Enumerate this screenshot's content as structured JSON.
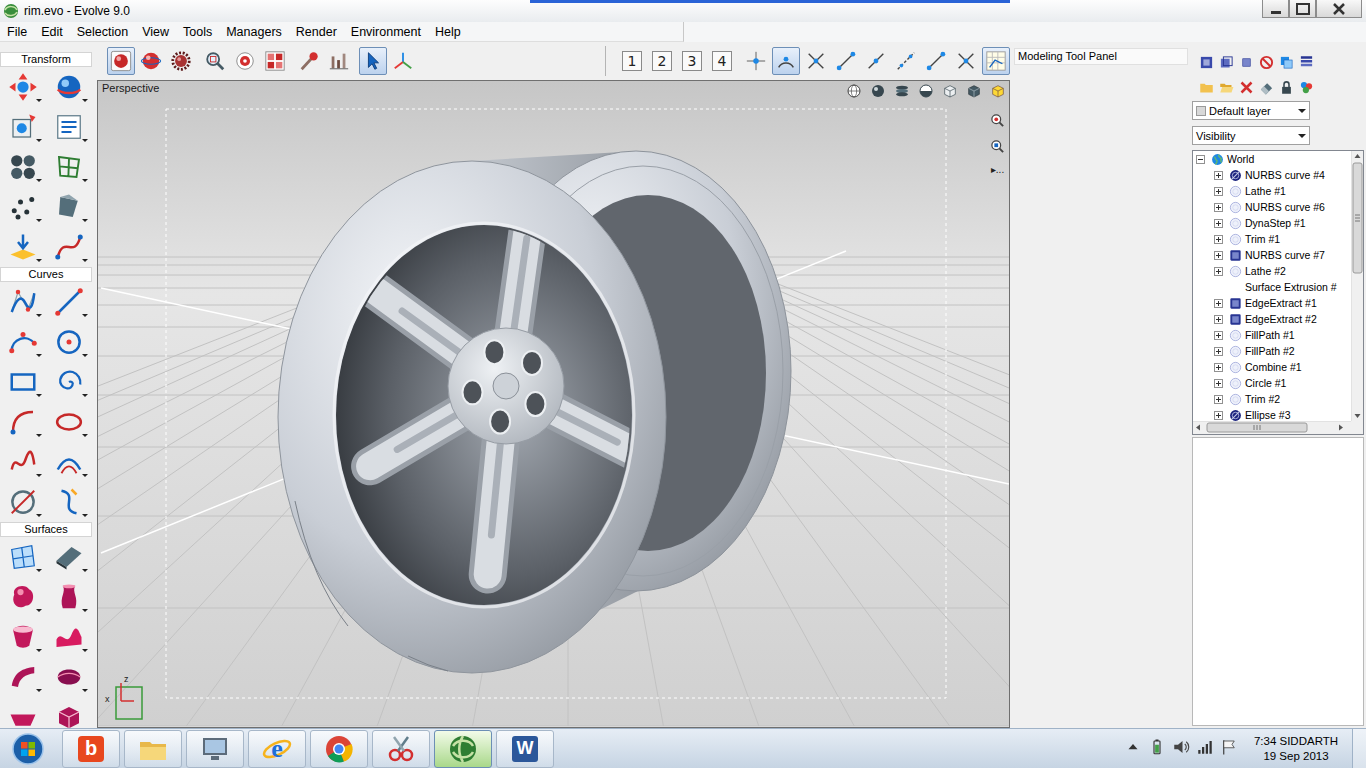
{
  "window": {
    "title": "rim.evo - Evolve 9.0"
  },
  "menu": [
    "File",
    "Edit",
    "Selection",
    "View",
    "Tools",
    "Managers",
    "Render",
    "Environment",
    "Help"
  ],
  "toolbar": {
    "left": [
      [
        {
          "kind": "render",
          "selected": true
        },
        {
          "kind": "red-sphere",
          "selected": false
        },
        {
          "kind": "gear",
          "selected": false
        }
      ],
      [
        {
          "kind": "zoom-fit",
          "selected": false
        },
        {
          "kind": "zoom-red",
          "selected": false
        },
        {
          "kind": "quad",
          "selected": false
        }
      ],
      [
        {
          "kind": "brush",
          "selected": false
        },
        {
          "kind": "measure",
          "selected": false
        }
      ],
      [
        {
          "kind": "pointer",
          "selected": true
        },
        {
          "kind": "axes",
          "selected": false
        }
      ]
    ],
    "right": [
      [
        {
          "kind": "view",
          "label": "1",
          "selected": false
        },
        {
          "kind": "view",
          "label": "2",
          "selected": false
        },
        {
          "kind": "view",
          "label": "3",
          "selected": false
        },
        {
          "kind": "view",
          "label": "4",
          "selected": false
        }
      ],
      [
        {
          "kind": "snap-point",
          "selected": false
        },
        {
          "kind": "snap-arc",
          "selected": true
        },
        {
          "kind": "snap-cross",
          "selected": false
        },
        {
          "kind": "snap-end",
          "selected": false
        },
        {
          "kind": "snap-mid",
          "selected": false
        },
        {
          "kind": "snap-dash",
          "selected": false
        },
        {
          "kind": "snap-end",
          "selected": false
        },
        {
          "kind": "snap-cross",
          "selected": false
        },
        {
          "kind": "snap-grid",
          "selected": true
        }
      ]
    ]
  },
  "tool_sections": [
    {
      "title": "Transform",
      "tools": [
        "move",
        "rotate",
        "move-frame",
        "props",
        "array",
        "lattice",
        "points",
        "twist",
        "drop",
        "path"
      ]
    },
    {
      "title": "Curves",
      "tools": [
        "curve",
        "line",
        "arc",
        "circle",
        "rect",
        "spiral",
        "arc-open",
        "ellipse",
        "freeform",
        "offset",
        "circle-cut",
        "scurve"
      ]
    },
    {
      "title": "Surfaces",
      "tools": [
        "patch",
        "plane",
        "blob",
        "vase",
        "lathe",
        "wave",
        "sweep",
        "shell",
        "boat",
        "solid"
      ]
    }
  ],
  "viewport": {
    "label": "Perspective",
    "more": "▸...",
    "gizmo": {
      "z": "z",
      "x": "x"
    }
  },
  "tool_panel": {
    "title": "Modeling Tool Panel"
  },
  "layers": {
    "layer": "Default layer",
    "filter": "Visibility"
  },
  "tree": {
    "items": [
      {
        "label": "World",
        "kind": "world",
        "depth": 0,
        "expanded": true,
        "leaf": false
      },
      {
        "label": "NURBS curve #4",
        "kind": "dark",
        "depth": 1,
        "expanded": false,
        "leaf": false
      },
      {
        "label": "Lathe #1",
        "kind": "light",
        "depth": 1,
        "expanded": false,
        "leaf": false
      },
      {
        "label": "NURBS curve #6",
        "kind": "light",
        "depth": 1,
        "expanded": false,
        "leaf": false
      },
      {
        "label": "DynaStep #1",
        "kind": "light",
        "depth": 1,
        "expanded": false,
        "leaf": false
      },
      {
        "label": "Trim #1",
        "kind": "light",
        "depth": 1,
        "expanded": false,
        "leaf": false
      },
      {
        "label": "NURBS curve #7",
        "kind": "box",
        "depth": 1,
        "expanded": false,
        "leaf": false
      },
      {
        "label": "Lathe #2",
        "kind": "light",
        "depth": 1,
        "expanded": false,
        "leaf": false
      },
      {
        "label": "Surface Extrusion #",
        "kind": "none",
        "depth": 1,
        "expanded": false,
        "leaf": true
      },
      {
        "label": "EdgeExtract #1",
        "kind": "box",
        "depth": 1,
        "expanded": false,
        "leaf": false
      },
      {
        "label": "EdgeExtract #2",
        "kind": "box",
        "depth": 1,
        "expanded": false,
        "leaf": false
      },
      {
        "label": "FillPath #1",
        "kind": "light",
        "depth": 1,
        "expanded": false,
        "leaf": false
      },
      {
        "label": "FillPath #2",
        "kind": "light",
        "depth": 1,
        "expanded": false,
        "leaf": false
      },
      {
        "label": "Combine #1",
        "kind": "light",
        "depth": 1,
        "expanded": false,
        "leaf": false
      },
      {
        "label": "Circle #1",
        "kind": "light",
        "depth": 1,
        "expanded": false,
        "leaf": false
      },
      {
        "label": "Trim #2",
        "kind": "light",
        "depth": 1,
        "expanded": false,
        "leaf": false
      },
      {
        "label": "Ellipse #3",
        "kind": "dark",
        "depth": 1,
        "expanded": false,
        "leaf": false
      }
    ]
  },
  "taskbar": {
    "apps": [
      {
        "kind": "bing",
        "label": "b",
        "active": false
      },
      {
        "kind": "explorer",
        "active": false
      },
      {
        "kind": "manager",
        "active": false
      },
      {
        "kind": "ie",
        "label": "e",
        "active": false
      },
      {
        "kind": "chrome",
        "active": false
      },
      {
        "kind": "snip",
        "active": false
      },
      {
        "kind": "evolve",
        "active": true
      },
      {
        "kind": "word",
        "label": "W",
        "active": false
      }
    ],
    "clock": {
      "time": "7:34 SIDDARTH",
      "date": "19 Sep 2013"
    }
  }
}
